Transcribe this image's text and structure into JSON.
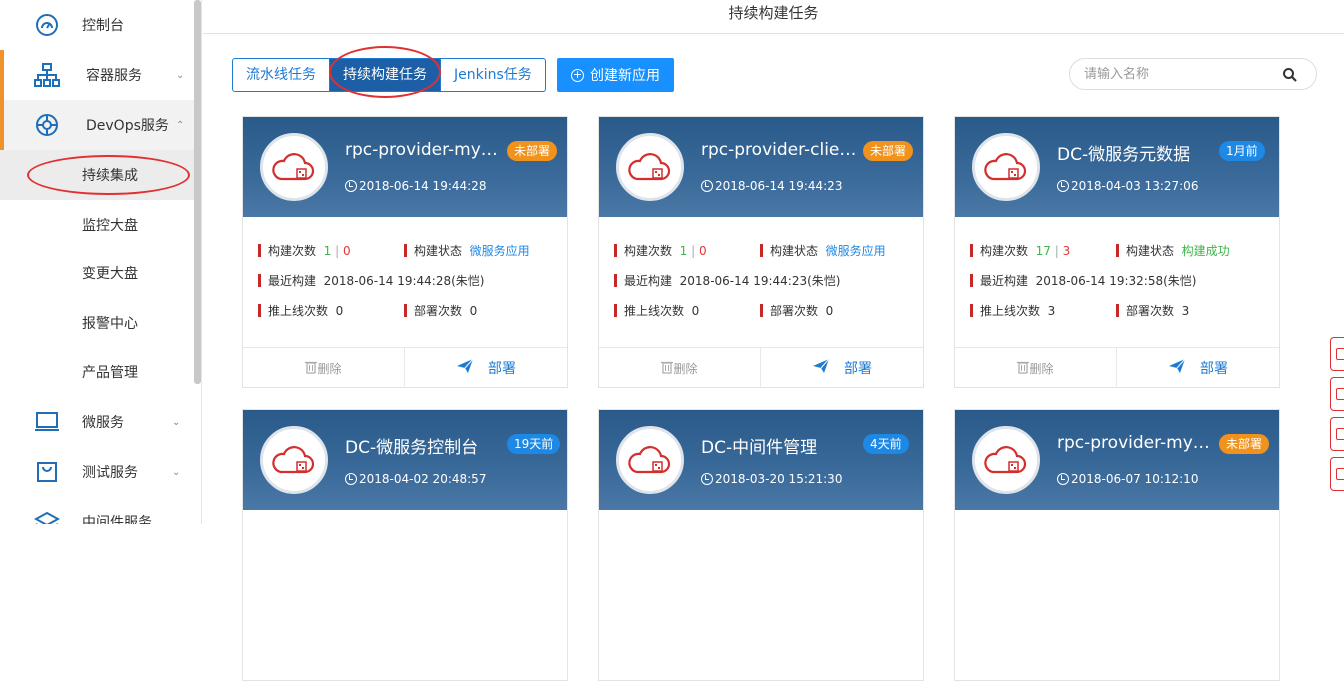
{
  "page_title": "持续构建任务",
  "sidebar": {
    "items": [
      {
        "label": "控制台",
        "icon": "dashboard-icon"
      },
      {
        "label": "容器服务",
        "icon": "container-tree-icon",
        "chevron": "⌄"
      },
      {
        "label": "DevOps服务",
        "icon": "devops-icon",
        "chevron": "⌃"
      },
      {
        "label": "微服务",
        "icon": "laptop-icon",
        "chevron": "⌄"
      },
      {
        "label": "测试服务",
        "icon": "cart-icon",
        "chevron": "⌄"
      },
      {
        "label": "中间件服务",
        "icon": "layers-icon"
      }
    ],
    "sub_items": [
      {
        "label": "持续集成"
      },
      {
        "label": "监控大盘"
      },
      {
        "label": "变更大盘"
      },
      {
        "label": "报警中心"
      },
      {
        "label": "产品管理"
      }
    ]
  },
  "tabs": [
    {
      "label": "流水线任务"
    },
    {
      "label": "持续构建任务"
    },
    {
      "label": "Jenkins任务"
    }
  ],
  "create_button": {
    "label": "创建新应用"
  },
  "search": {
    "placeholder": "请输入名称"
  },
  "labels": {
    "build_count": "构建次数",
    "build_status": "构建状态",
    "last_build": "最近构建",
    "promote_count": "推上线次数",
    "deploy_count": "部署次数",
    "delete": "删除",
    "deploy": "部署",
    "separator": "|"
  },
  "colors": {
    "accent": "#f0922b",
    "primary": "#1890ff",
    "header_blue": "#2a5a8a",
    "badge_orange": "#f0921c",
    "badge_blue": "#1e88e5"
  },
  "cards": [
    {
      "name": "rpc-provider-mysel...",
      "badge": "未部署",
      "badge_type": "orange",
      "time": "2018-06-14 19:44:28",
      "build_success": "1",
      "build_fail": "0",
      "status": "微服务应用",
      "status_color": "blue",
      "last_build": "2018-06-14 19:44:28(朱恺)",
      "promote_count": "0",
      "deploy_count": "0"
    },
    {
      "name": "rpc-provider-client...",
      "badge": "未部署",
      "badge_type": "orange",
      "time": "2018-06-14 19:44:23",
      "build_success": "1",
      "build_fail": "0",
      "status": "微服务应用",
      "status_color": "blue",
      "last_build": "2018-06-14 19:44:23(朱恺)",
      "promote_count": "0",
      "deploy_count": "0"
    },
    {
      "name": "DC-微服务元数据",
      "badge": "1月前",
      "badge_type": "blue",
      "time": "2018-04-03 13:27:06",
      "build_success": "17",
      "build_fail": "3",
      "status": "构建成功",
      "status_color": "green",
      "last_build": "2018-06-14 19:32:58(朱恺)",
      "promote_count": "3",
      "deploy_count": "3"
    },
    {
      "name": "DC-微服务控制台",
      "badge": "19天前",
      "badge_type": "blue",
      "time": "2018-04-02 20:48:57"
    },
    {
      "name": "DC-中间件管理",
      "badge": "4天前",
      "badge_type": "blue",
      "time": "2018-03-20 15:21:30"
    },
    {
      "name": "rpc-provider-mysel...",
      "badge": "未部署",
      "badge_type": "orange",
      "time": "2018-06-07 10:12:10"
    }
  ]
}
